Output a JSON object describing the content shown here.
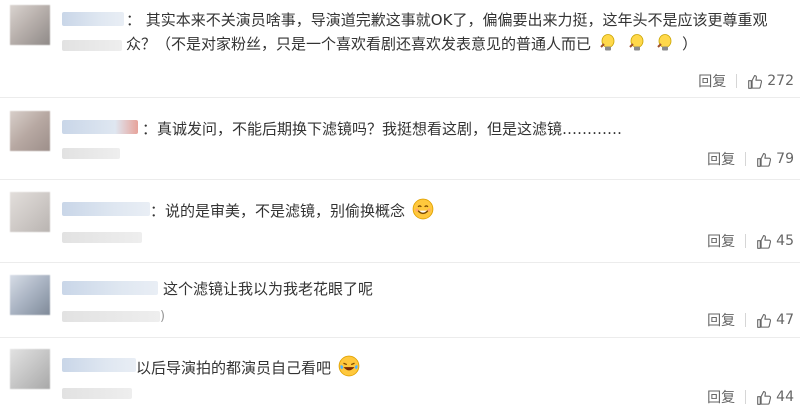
{
  "reply_label": "回复",
  "comments": [
    {
      "sep": "：",
      "text_main": "其实本来不关演员啥事，导演道完歉这事就OK了，偏偏要出来力挺，这年头不是应该更尊重观众？（不是对家粉丝，只是一个喜欢看剧还喜欢发表意见的普通人而已",
      "text_tail": "）",
      "emoji": [
        "bulb-emoji",
        "bulb-emoji",
        "bulb-emoji"
      ],
      "likes": "272"
    },
    {
      "sep": "：",
      "text_main": "真诚发问，不能后期换下滤镜吗？我挺想看这剧，但是这滤镜…………",
      "likes": "79"
    },
    {
      "sep": "：",
      "text_main": "说的是审美，不是滤镜，别偷换概念",
      "emoji": [
        "smile-emoji"
      ],
      "likes": "45"
    },
    {
      "sep": "",
      "text_main": "这个滤镜让我以为我老花眼了呢",
      "meta_tail": ")",
      "likes": "47"
    },
    {
      "sep": "",
      "text_main": "以后导演拍的都演员自己看吧",
      "emoji": [
        "laugh-cry-emoji"
      ],
      "likes": "44"
    }
  ]
}
